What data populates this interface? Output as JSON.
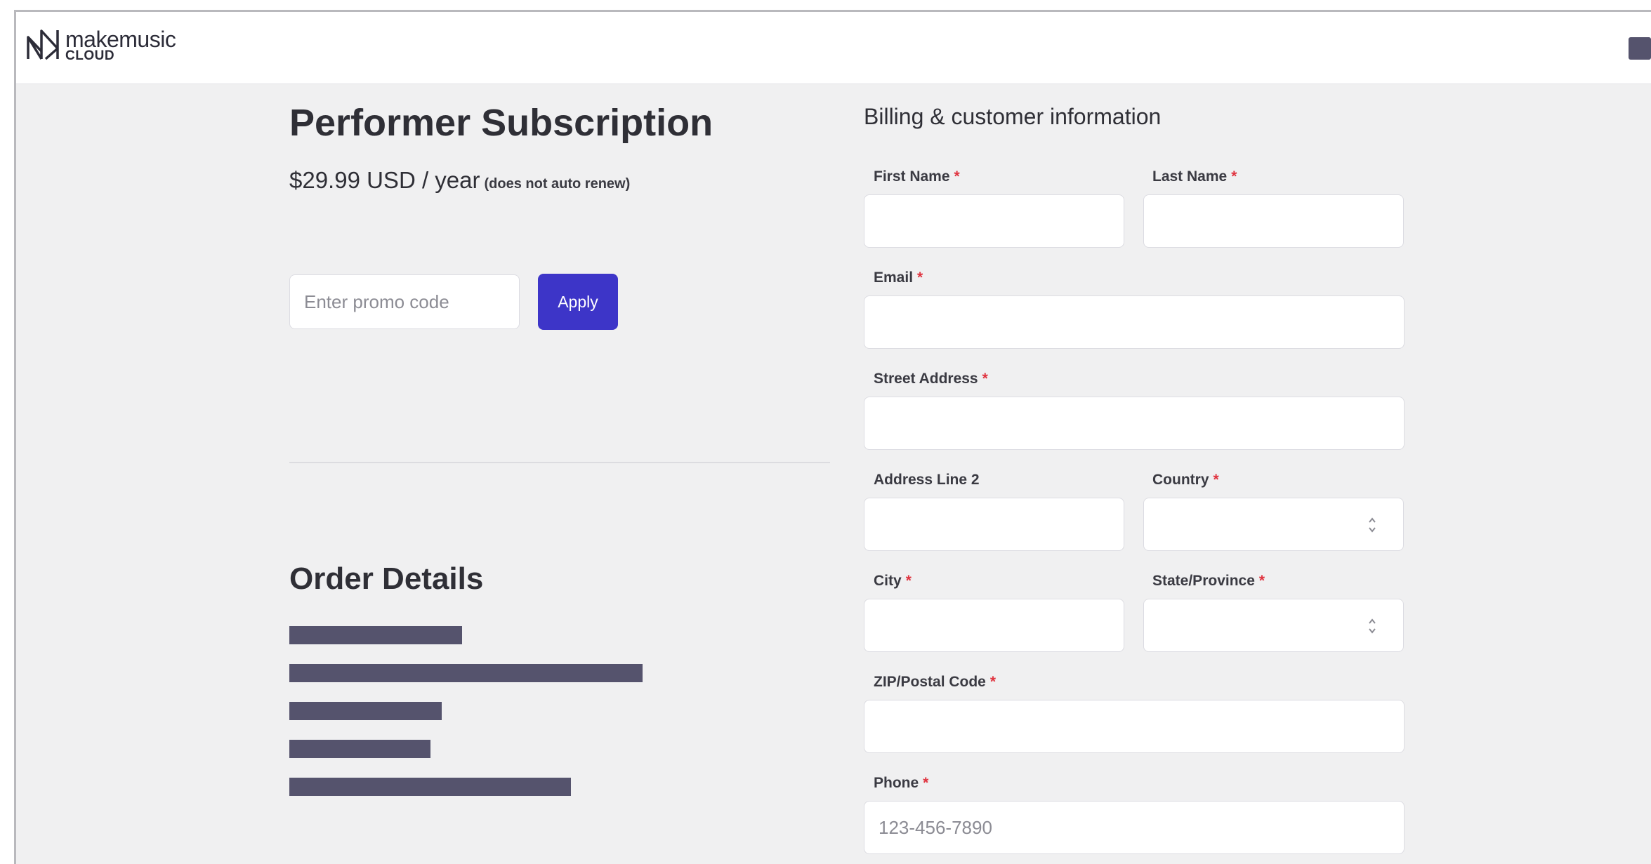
{
  "header": {
    "logo_word": "makemusic",
    "logo_sub": "CLOUD"
  },
  "product": {
    "title": "Performer Subscription",
    "price": "$29.99 USD / year",
    "price_note": "(does not auto renew)"
  },
  "promo": {
    "placeholder": "Enter promo code",
    "apply_label": "Apply"
  },
  "order": {
    "title": "Order Details"
  },
  "billing": {
    "title": "Billing & customer information",
    "required_mark": "*",
    "first_name_label": "First Name",
    "last_name_label": "Last Name",
    "email_label": "Email",
    "street_label": "Street Address",
    "address2_label": "Address Line 2",
    "country_label": "Country",
    "city_label": "City",
    "state_label": "State/Province",
    "zip_label": "ZIP/Postal Code",
    "phone_label": "Phone",
    "phone_placeholder": "123-456-7890"
  },
  "colors": {
    "accent": "#3d35c8",
    "required": "#e0333f",
    "redaction": "#55536d",
    "background": "#f0f0f1"
  }
}
